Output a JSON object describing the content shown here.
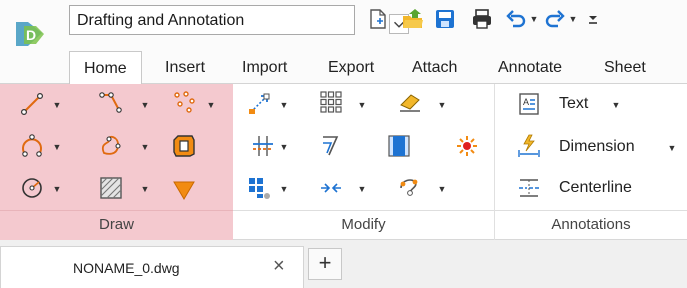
{
  "quick_access": {
    "workspace_value": "Drafting and Annotation",
    "icons": [
      "new-file-icon",
      "open-folder-icon",
      "save-icon",
      "print-icon",
      "undo-icon",
      "redo-icon",
      "customize-icon"
    ]
  },
  "tabs": [
    {
      "label": "Home",
      "active": true
    },
    {
      "label": "Insert"
    },
    {
      "label": "Import"
    },
    {
      "label": "Export"
    },
    {
      "label": "Attach"
    },
    {
      "label": "Annotate"
    },
    {
      "label": "Sheet"
    }
  ],
  "ribbon": {
    "draw": {
      "title": "Draw",
      "tools": [
        "line-icon",
        "polyline-icon",
        "point-icon",
        "arc-icon",
        "spline-icon",
        "region-icon",
        "circle-icon",
        "hatch-icon",
        "triangle-icon"
      ]
    },
    "modify": {
      "title": "Modify",
      "tools": [
        "move-icon",
        "array-icon",
        "erase-icon",
        "trim-icon",
        "offset-icon",
        "edit-icon",
        "explode-icon",
        "stretch-icon",
        "fillet-icon",
        "scale-icon"
      ]
    },
    "annotations": {
      "title": "Annotations",
      "text_label": "Text",
      "dimension_label": "Dimension",
      "centerline_label": "Centerline"
    }
  },
  "document": {
    "tab_name": "NONAME_0.dwg",
    "close_glyph": "×",
    "add_glyph": "+"
  },
  "colors": {
    "draw_panel_bg": "#f4c9cf",
    "accent_blue": "#1e73d2",
    "accent_orange": "#f28b12"
  }
}
